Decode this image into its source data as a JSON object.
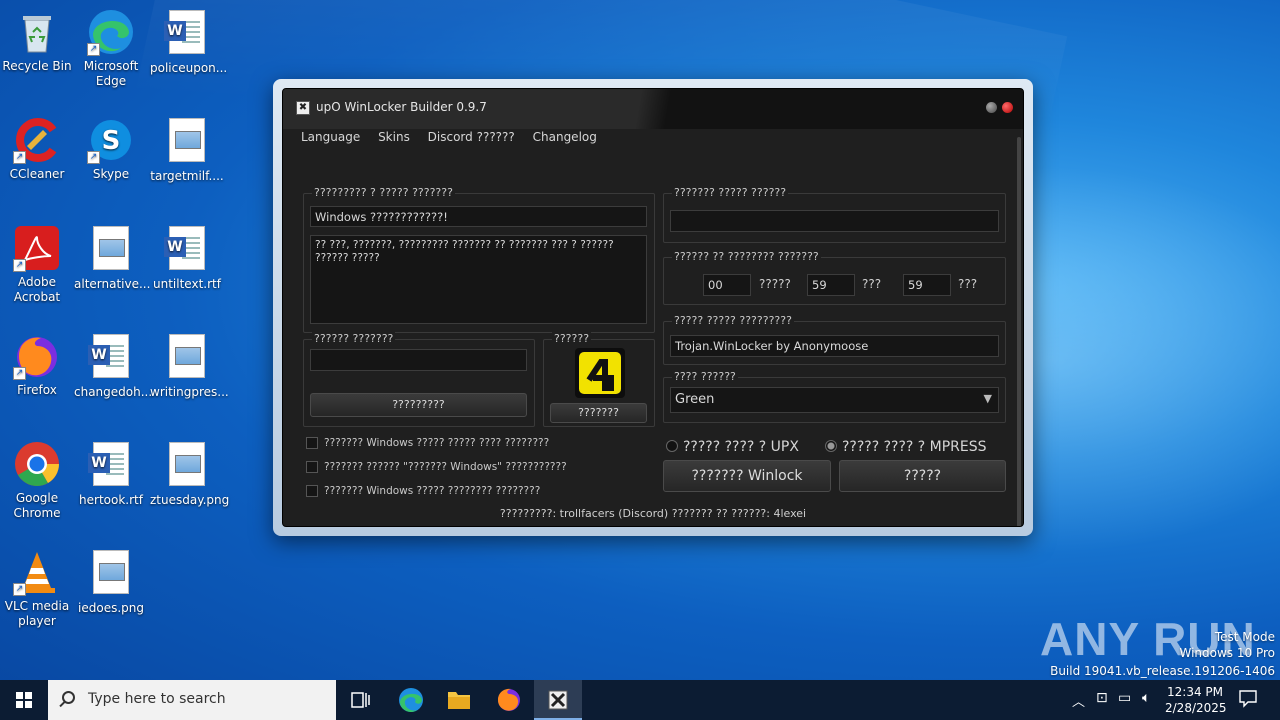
{
  "desktop": {
    "icons": [
      {
        "label": "Recycle Bin"
      },
      {
        "label": "Microsoft Edge"
      },
      {
        "label": "policeupon..."
      },
      {
        "label": "CCleaner"
      },
      {
        "label": "Skype"
      },
      {
        "label": "targetmilf...."
      },
      {
        "label": "Adobe Acrobat"
      },
      {
        "label": "alternative..."
      },
      {
        "label": "untiltext.rtf"
      },
      {
        "label": "Firefox"
      },
      {
        "label": "changedoh..."
      },
      {
        "label": "writingpres..."
      },
      {
        "label": "Google Chrome"
      },
      {
        "label": "hertook.rtf"
      },
      {
        "label": "ztuesday.png"
      },
      {
        "label": "VLC media player"
      },
      {
        "label": "iedoes.png"
      }
    ]
  },
  "window": {
    "title": "upO WinLocker Builder 0.9.7",
    "menu": [
      "Language",
      "Skins",
      "Discord ??????",
      "Changelog"
    ],
    "message_group": {
      "label": "????????? ? ????? ???????",
      "title_value": "Windows ????????????!",
      "body_value": "?? ???, ???????, ????????? ??????? ?? ??????? ??? ? ?????? ?????? ?????"
    },
    "password_group": {
      "label": "?????? ???????",
      "value": "",
      "button": "?????????"
    },
    "icon_group": {
      "label": "??????",
      "button": "???????"
    },
    "checkboxes": [
      "??????? Windows ????? ????? ???? ????????",
      "??????? ?????? \"??????? Windows\" ???????????",
      "??????? Windows ????? ???????? ????????"
    ],
    "unlock_group": {
      "label": "??????? ????? ??????",
      "value": ""
    },
    "timer_group": {
      "label": "?????? ?? ???????? ???????",
      "hours": "00",
      "hours_unit": "?????",
      "minutes": "59",
      "minutes_unit": "???",
      "seconds": "59",
      "seconds_unit": "???"
    },
    "name_group": {
      "label": "????? ????? ?????????",
      "value": "Trojan.WinLocker by Anonymoose"
    },
    "skin_group": {
      "label": "???? ??????",
      "selected": "Green"
    },
    "compress": {
      "upx": "????? ???? ? UPX",
      "mpress": "????? ???? ? MPRESS"
    },
    "build_button": "??????? Winlock",
    "exit_button": "?????",
    "status": "?????????: trollfacers (Discord) ??????? ?? ??????: 4lexei"
  },
  "watermark": {
    "brand": "ANY RUN",
    "mode": "Test Mode",
    "os": "Windows 10 Pro",
    "build": "Build 19041.vb_release.191206-1406"
  },
  "taskbar": {
    "search_placeholder": "Type here to search",
    "time": "12:34 PM",
    "date": "2/28/2025"
  }
}
